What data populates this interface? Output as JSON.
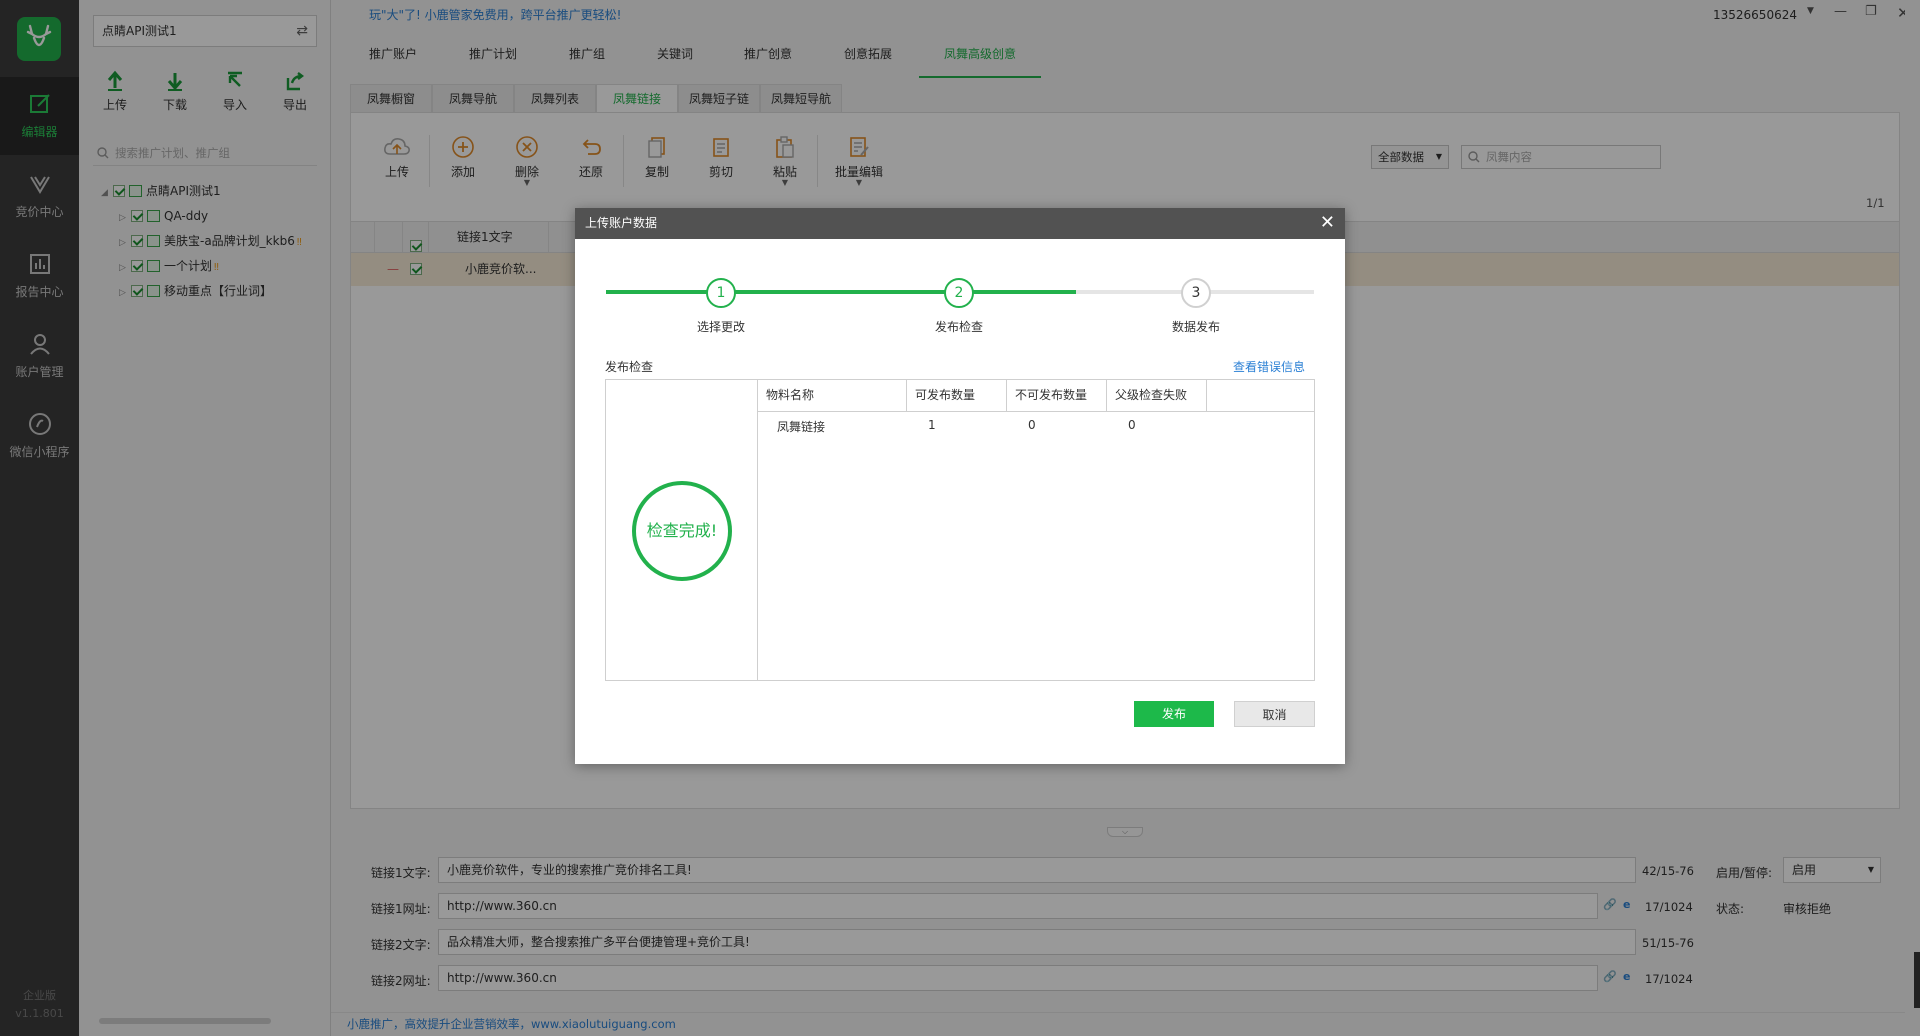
{
  "left_nav": {
    "logo": "deer-logo-icon",
    "items": [
      {
        "label": "编辑器",
        "icon": "edit-icon",
        "active": true
      },
      {
        "label": "竞价中心",
        "icon": "bid-icon",
        "active": false
      },
      {
        "label": "报告中心",
        "icon": "report-icon",
        "active": false
      },
      {
        "label": "账户管理",
        "icon": "user-icon",
        "active": false
      },
      {
        "label": "微信小程序",
        "icon": "mini-program-icon",
        "active": false
      }
    ],
    "edition": "企业版",
    "version": "v1.1.801"
  },
  "tree_panel": {
    "account_name": "点睛API测试1",
    "switch_icon": "switch-icon",
    "toolbar": [
      {
        "label": "上传",
        "icon": "upload-icon"
      },
      {
        "label": "下载",
        "icon": "download-icon"
      },
      {
        "label": "导入",
        "icon": "import-icon"
      },
      {
        "label": "导出",
        "icon": "export-icon"
      }
    ],
    "search_placeholder": "搜索推广计划、推广组",
    "tree": {
      "root": "点睛API测试1",
      "children": [
        {
          "label": "QA-ddy",
          "warn": ""
        },
        {
          "label": "美肤宝-a品牌计划_kkb6",
          "warn": "‼"
        },
        {
          "label": "一个计划",
          "warn": "‼"
        },
        {
          "label": "移动重点【行业词】",
          "warn": ""
        }
      ]
    }
  },
  "header": {
    "promo": "玩\"大\"了! 小鹿管家免费用，跨平台推广更轻松!",
    "user_id": "13526650624",
    "main_tabs": [
      "推广账户",
      "推广计划",
      "推广组",
      "关键词",
      "推广创意",
      "创意拓展",
      "凤舞高级创意"
    ],
    "active_main_tab": 6,
    "sub_tabs": [
      "凤舞橱窗",
      "凤舞导航",
      "凤舞列表",
      "凤舞链接",
      "凤舞短子链",
      "凤舞短导航"
    ],
    "active_sub_tab": 3
  },
  "toolbar": {
    "items": [
      {
        "label": "上传",
        "icon": "cloud-upload-icon"
      },
      {
        "label": "添加",
        "icon": "add-icon"
      },
      {
        "label": "删除",
        "icon": "delete-icon"
      },
      {
        "label": "还原",
        "icon": "undo-icon"
      },
      {
        "label": "复制",
        "icon": "copy-icon"
      },
      {
        "label": "剪切",
        "icon": "cut-icon"
      },
      {
        "label": "粘贴",
        "icon": "paste-icon"
      },
      {
        "label": "批量编辑",
        "icon": "batch-edit-icon"
      }
    ],
    "filter_select": "全部数据",
    "search_placeholder": "凤舞内容",
    "pager": "1/1"
  },
  "grid": {
    "columns": [
      "链接1文字"
    ],
    "rows": [
      {
        "status": "—",
        "text": "小鹿竞价软..."
      }
    ]
  },
  "detail": {
    "fields": [
      {
        "label": "链接1文字:",
        "value": "小鹿竞价软件，专业的搜索推广竞价排名工具!",
        "count": "42/15-76"
      },
      {
        "label": "链接1网址:",
        "value": "http://www.360.cn",
        "count": "17/1024"
      },
      {
        "label": "链接2文字:",
        "value": "品众精准大师，整合搜索推广多平台便捷管理+竞价工具!",
        "count": "51/15-76"
      },
      {
        "label": "链接2网址:",
        "value": "http://www.360.cn",
        "count": "17/1024"
      }
    ],
    "toggle_label": "启用/暂停:",
    "toggle_value": "启用",
    "status_label": "状态:",
    "status_value": "审核拒绝"
  },
  "status_bar": "小鹿推广，高效提升企业营销效率，www.xiaolutuiguang.com",
  "modal": {
    "title": "上传账户数据",
    "steps": [
      {
        "num": "1",
        "label": "选择更改",
        "done": true
      },
      {
        "num": "2",
        "label": "发布检查",
        "done": true
      },
      {
        "num": "3",
        "label": "数据发布",
        "done": false
      }
    ],
    "section_title": "发布检查",
    "error_link": "查看错误信息",
    "result_text": "检查完成!",
    "table": {
      "headers": [
        "物料名称",
        "可发布数量",
        "不可发布数量",
        "父级检查失败"
      ],
      "rows": [
        [
          "凤舞链接",
          "1",
          "0",
          "0"
        ]
      ]
    },
    "publish_button": "发布",
    "cancel_button": "取消"
  },
  "colors": {
    "accent": "#22b14c",
    "link": "#2a7fd4",
    "nav_bg": "#3d3d3d",
    "modal_header": "#525252"
  }
}
